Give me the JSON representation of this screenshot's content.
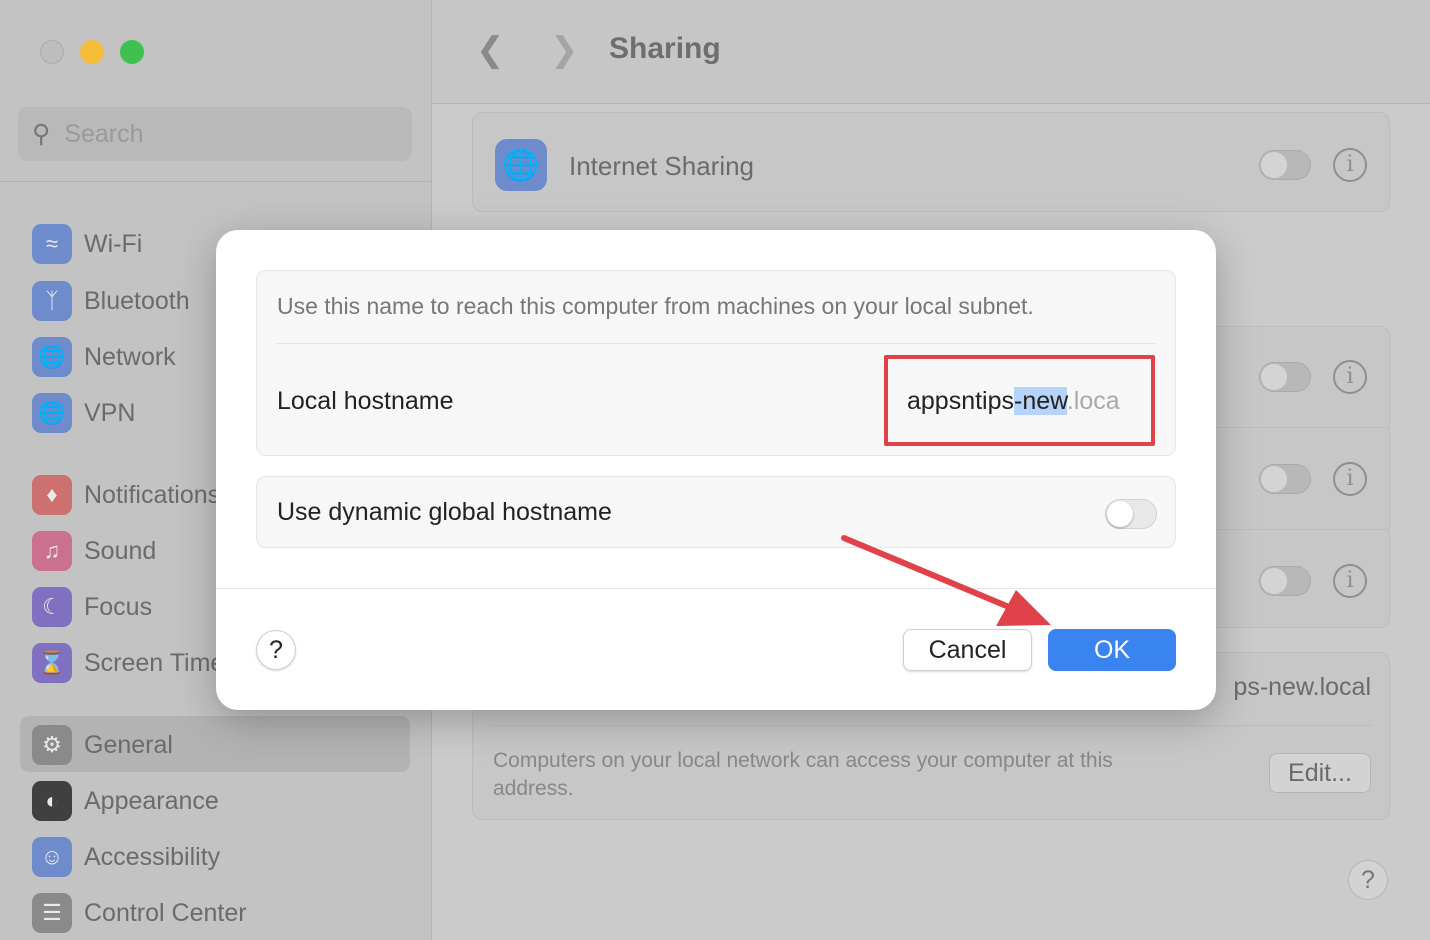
{
  "window": {
    "title": "Sharing"
  },
  "sidebar": {
    "search_placeholder": "Search",
    "items": [
      {
        "label": "Wi-Fi",
        "icon": "wifi-icon",
        "color": "#6e8ccc"
      },
      {
        "label": "Bluetooth",
        "icon": "bluetooth-icon",
        "color": "#6e8ccc"
      },
      {
        "label": "Network",
        "icon": "globe-icon",
        "color": "#6e8ccc"
      },
      {
        "label": "VPN",
        "icon": "vpn-globe-icon",
        "color": "#6e8ccc"
      },
      {
        "label": "Notifications",
        "icon": "bell-icon",
        "color": "#cc7070"
      },
      {
        "label": "Sound",
        "icon": "speaker-icon",
        "color": "#cc7090"
      },
      {
        "label": "Focus",
        "icon": "moon-icon",
        "color": "#8070c0"
      },
      {
        "label": "Screen Time",
        "icon": "hourglass-icon",
        "color": "#8070c0"
      },
      {
        "label": "General",
        "icon": "gear-icon",
        "color": "#8a8a8a"
      },
      {
        "label": "Appearance",
        "icon": "appearance-icon",
        "color": "#404040"
      },
      {
        "label": "Accessibility",
        "icon": "accessibility-icon",
        "color": "#6e8ccc"
      },
      {
        "label": "Control Center",
        "icon": "control-center-icon",
        "color": "#8a8a8a"
      }
    ]
  },
  "main": {
    "internet_sharing": "Internet Sharing",
    "hostname_partial": "ps-new.local",
    "address_note": "Computers on your local network can access your computer at this address.",
    "edit_label": "Edit...",
    "help": "?"
  },
  "dialog": {
    "description": "Use this name to reach this computer from machines on your local subnet.",
    "local_hostname_label": "Local hostname",
    "hostname_prefix": "appsntips",
    "hostname_selected": "-new",
    "hostname_suffix": ".loca",
    "dynamic_label": "Use dynamic global hostname",
    "dynamic_enabled": false,
    "help": "?",
    "cancel": "Cancel",
    "ok": "OK",
    "accent": "#3a84f0",
    "annotation_color": "#e0424a"
  }
}
